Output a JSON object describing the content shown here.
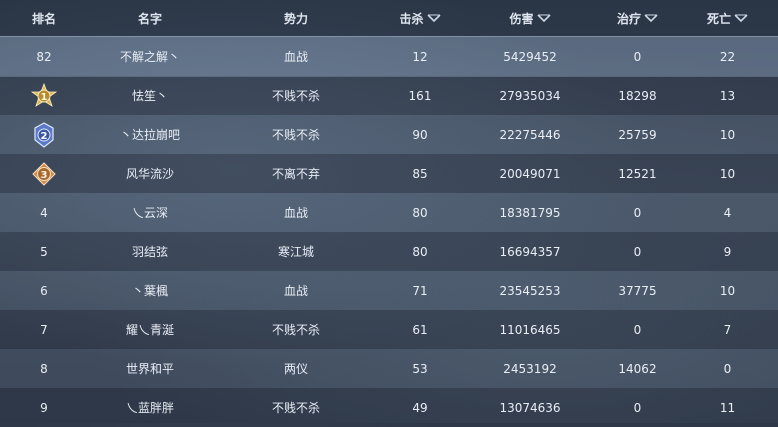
{
  "header": {
    "rank": "排名",
    "name": "名字",
    "faction": "势力",
    "kills": "击杀",
    "damage": "伤害",
    "healing": "治疗",
    "deaths": "死亡"
  },
  "self_row": {
    "rank": "82",
    "name": "不解之解丶",
    "faction": "血战",
    "kills": "12",
    "damage": "5429452",
    "healing": "0",
    "deaths": "22"
  },
  "rows": [
    {
      "rank": "1",
      "medal": "gold-medal-icon",
      "name": "怯笙丶",
      "faction": "不贱不杀",
      "kills": "161",
      "damage": "27935034",
      "healing": "18298",
      "deaths": "13"
    },
    {
      "rank": "2",
      "medal": "silver-medal-icon",
      "name": "丶达拉崩吧",
      "faction": "不贱不杀",
      "kills": "90",
      "damage": "22275446",
      "healing": "25759",
      "deaths": "10"
    },
    {
      "rank": "3",
      "medal": "bronze-medal-icon",
      "name": "风华流沙",
      "faction": "不离不弃",
      "kills": "85",
      "damage": "20049071",
      "healing": "12521",
      "deaths": "10"
    },
    {
      "rank": "4",
      "name": "乀云深",
      "faction": "血战",
      "kills": "80",
      "damage": "18381795",
      "healing": "0",
      "deaths": "4"
    },
    {
      "rank": "5",
      "name": "羽结弦",
      "faction": "寒江城",
      "kills": "80",
      "damage": "16694357",
      "healing": "0",
      "deaths": "9"
    },
    {
      "rank": "6",
      "name": "丶葉楓",
      "faction": "血战",
      "kills": "71",
      "damage": "23545253",
      "healing": "37775",
      "deaths": "10"
    },
    {
      "rank": "7",
      "name": "耀乀青涎",
      "faction": "不贱不杀",
      "kills": "61",
      "damage": "11016465",
      "healing": "0",
      "deaths": "7"
    },
    {
      "rank": "8",
      "name": "世界和平",
      "faction": "两仪",
      "kills": "53",
      "damage": "2453192",
      "healing": "14062",
      "deaths": "0"
    },
    {
      "rank": "9",
      "name": "乀蓝胖胖",
      "faction": "不贱不杀",
      "kills": "49",
      "damage": "13074636",
      "healing": "0",
      "deaths": "11"
    }
  ],
  "colors": {
    "gold": "#d8b35a",
    "silver": "#5a78c8",
    "bronze": "#c98a4a"
  }
}
